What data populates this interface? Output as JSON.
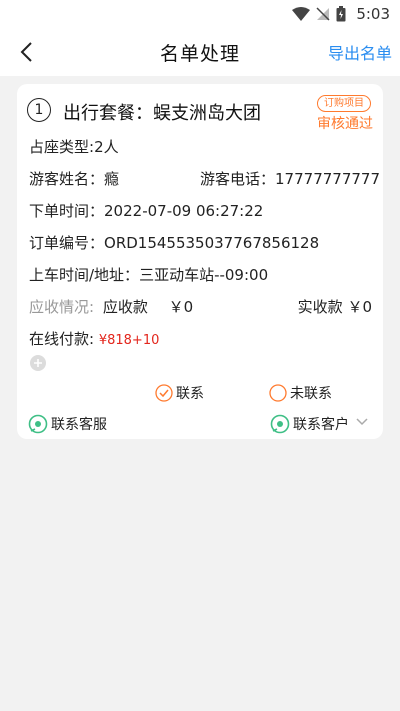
{
  "status_bar": {
    "time": "5:03"
  },
  "nav": {
    "title": "名单处理",
    "export_label": "导出名单"
  },
  "order": {
    "index": "1",
    "package_label": "出行套餐：",
    "package_name": "蜈支洲岛大团",
    "badge": "订购项目",
    "audit_status": "审核通过",
    "seat_type_label": "占座类型:",
    "seat_type": "2人",
    "guest_name_label": "游客姓名：",
    "guest_name": "瘾",
    "guest_phone_label": "游客电话：",
    "guest_phone": "17777777777",
    "order_time_label": "下单时间：",
    "order_time": "2022-07-09 06:27:22",
    "order_no_label": "订单编号：",
    "order_no": "ORD1545535037767856128",
    "boarding_label": "上车时间/地址：",
    "boarding": "三亚动车站--09:00",
    "receivable_status_label": "应收情况:",
    "receivable_label": "应收款",
    "receivable_value": "￥0",
    "received_label": "实收款",
    "received_value": "￥0",
    "online_pay_label": "在线付款:",
    "online_pay_value": "¥818+10",
    "contacted_label": "联系",
    "not_contacted_label": "未联系",
    "contact_service_label": "联系客服",
    "contact_customer_label": "联系客户"
  },
  "colors": {
    "accent": "#2a8df0",
    "orange": "#ff7a2e",
    "red": "#e3261c",
    "green": "#3fbf86"
  }
}
